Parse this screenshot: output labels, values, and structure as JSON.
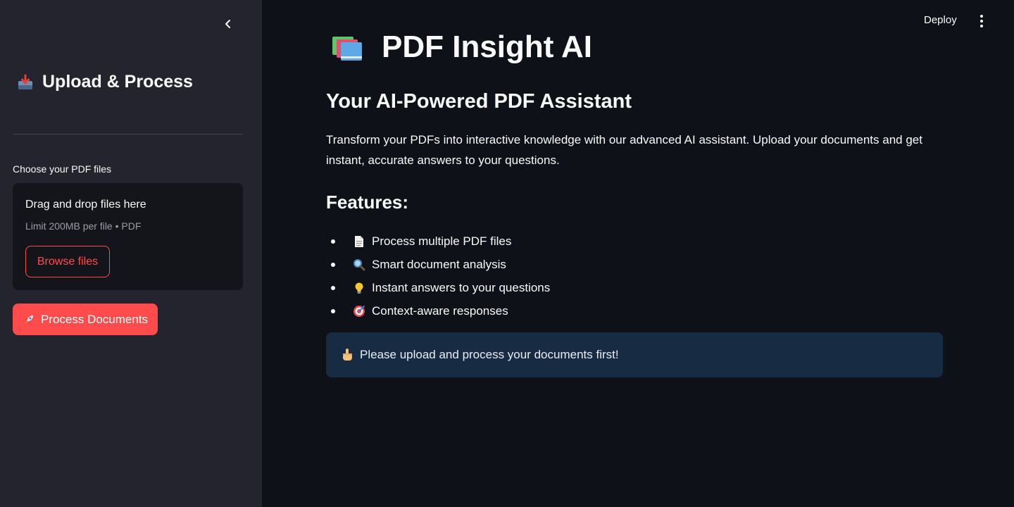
{
  "sidebar": {
    "title": "Upload & Process",
    "title_icon": "inbox-tray-icon",
    "uploader": {
      "label": "Choose your PDF files",
      "drop_title": "Drag and drop files here",
      "limit_text": "Limit 200MB per file • PDF",
      "browse_label": "Browse files"
    },
    "process_button": {
      "label": "Process Documents",
      "icon": "rocket-icon"
    }
  },
  "header": {
    "deploy_label": "Deploy"
  },
  "main": {
    "title": "PDF Insight AI",
    "title_icon": "books-icon",
    "subtitle": "Your AI-Powered PDF Assistant",
    "intro": "Transform your PDFs into interactive knowledge with our advanced AI assistant. Upload your documents and get instant, accurate answers to your questions.",
    "features_heading": "Features:",
    "features": [
      {
        "icon": "page-icon",
        "label": "Process multiple PDF files"
      },
      {
        "icon": "magnifier-icon",
        "label": "Smart document analysis"
      },
      {
        "icon": "lightbulb-icon",
        "label": "Instant answers to your questions"
      },
      {
        "icon": "target-icon",
        "label": "Context-aware responses"
      }
    ],
    "info_message": "Please upload and process your documents first!",
    "info_icon": "pointing-hand-icon"
  },
  "colors": {
    "accent": "#ff4b4b",
    "sidebar_bg": "#23242d",
    "main_bg": "#0e1117",
    "info_bg": "#172b43"
  }
}
